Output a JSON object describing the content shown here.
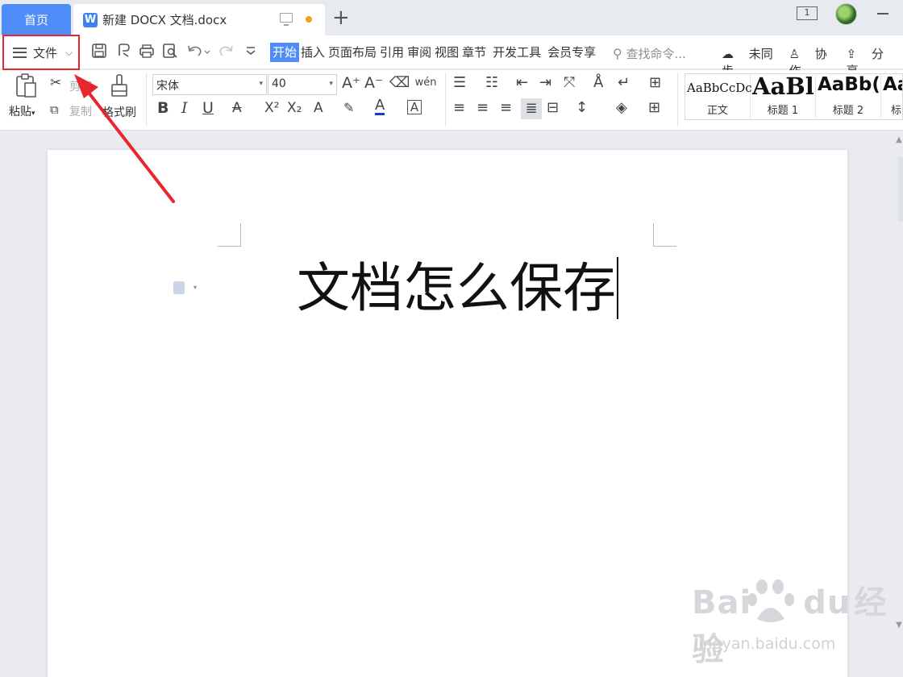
{
  "titlebar": {
    "home_tab": "首页",
    "doc_tab": {
      "icon_letter": "W",
      "title": "新建 DOCX 文档.docx"
    },
    "new_tab": "+",
    "window_count": "1"
  },
  "menubar": {
    "file_label": "文件",
    "tabs": [
      "开始",
      "插入",
      "页面布局",
      "引用",
      "审阅",
      "视图",
      "章节",
      "开发工具",
      "会员专享"
    ],
    "active_tab": "开始",
    "search_placeholder": "查找命令...",
    "sync": "未同步",
    "collab": "协作",
    "share": "分享"
  },
  "ribbon": {
    "paste": "粘贴",
    "cut": "剪切",
    "copy": "复制",
    "format_painter": "格式刷",
    "font_name": "宋体",
    "font_size": "40",
    "bold": "B",
    "italic": "I",
    "underline": "U",
    "strike": "A",
    "superscript": "X²",
    "subscript": "X₂",
    "font_grow": "A⁺",
    "font_shrink": "A⁻",
    "phonetic": "wén",
    "styles": [
      {
        "sample": "AaBbCcDc",
        "name": "正文"
      },
      {
        "sample": "AaBl",
        "name": "标题 1"
      },
      {
        "sample": "AaBb(",
        "name": "标题 2"
      },
      {
        "sample": "Aa",
        "name": "标"
      }
    ]
  },
  "document": {
    "heading": "文档怎么保存"
  },
  "watermark": {
    "brand_left": "Bai",
    "brand_right": "du",
    "brand_cn": "经验",
    "url": "jingyan.baidu.com"
  },
  "colors": {
    "accent": "#4f8cf7",
    "annotation": "#e8262d",
    "unsaved_dot": "#f0a020"
  }
}
